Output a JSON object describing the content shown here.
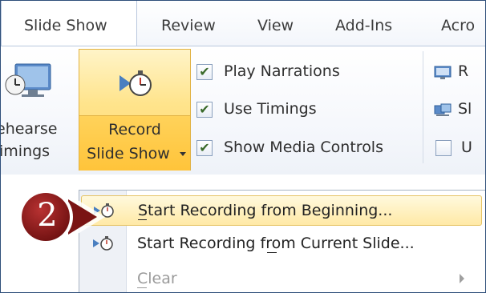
{
  "tabs": [
    {
      "label": "Slide Show",
      "active": true
    },
    {
      "label": "Review",
      "active": false
    },
    {
      "label": "View",
      "active": false
    },
    {
      "label": "Add-Ins",
      "active": false
    },
    {
      "label": "Acro",
      "active": false
    }
  ],
  "ribbon": {
    "rehearse": {
      "line1": "ehearse",
      "line2": "imings",
      "icon": "rehearse-timings-icon"
    },
    "record": {
      "line1": "Record",
      "line2": "Slide Show",
      "icon": "stopwatch-play-icon",
      "dropdown_icon": "chevron-down-icon"
    },
    "checkboxes": [
      {
        "label": "Play Narrations",
        "checked": true
      },
      {
        "label": "Use Timings",
        "checked": true
      },
      {
        "label": "Show Media Controls",
        "checked": true
      }
    ],
    "right_group": [
      {
        "label": "R",
        "icon": "monitor-icon"
      },
      {
        "label": "Sl",
        "icon": "presenter-view-icon"
      },
      {
        "label": "U",
        "icon": "checkbox-icon",
        "checked": false
      }
    ]
  },
  "menu": {
    "items": [
      {
        "label": "Start Recording from Beginning...",
        "mnemonic": "S",
        "icon": "stopwatch-play-icon",
        "highlighted": true,
        "enabled": true
      },
      {
        "label": "Start Recording from Current Slide...",
        "mnemonic": "R",
        "icon": "stopwatch-play-icon",
        "highlighted": false,
        "enabled": true
      },
      {
        "label": "Clear",
        "mnemonic": "C",
        "icon": "",
        "highlighted": false,
        "enabled": false,
        "has_submenu": true
      }
    ]
  },
  "step_marker": {
    "number": "2"
  },
  "colors": {
    "highlight": "#ffe9a6",
    "step_marker": "#8b1a1a",
    "border": "#2f4f7a"
  }
}
